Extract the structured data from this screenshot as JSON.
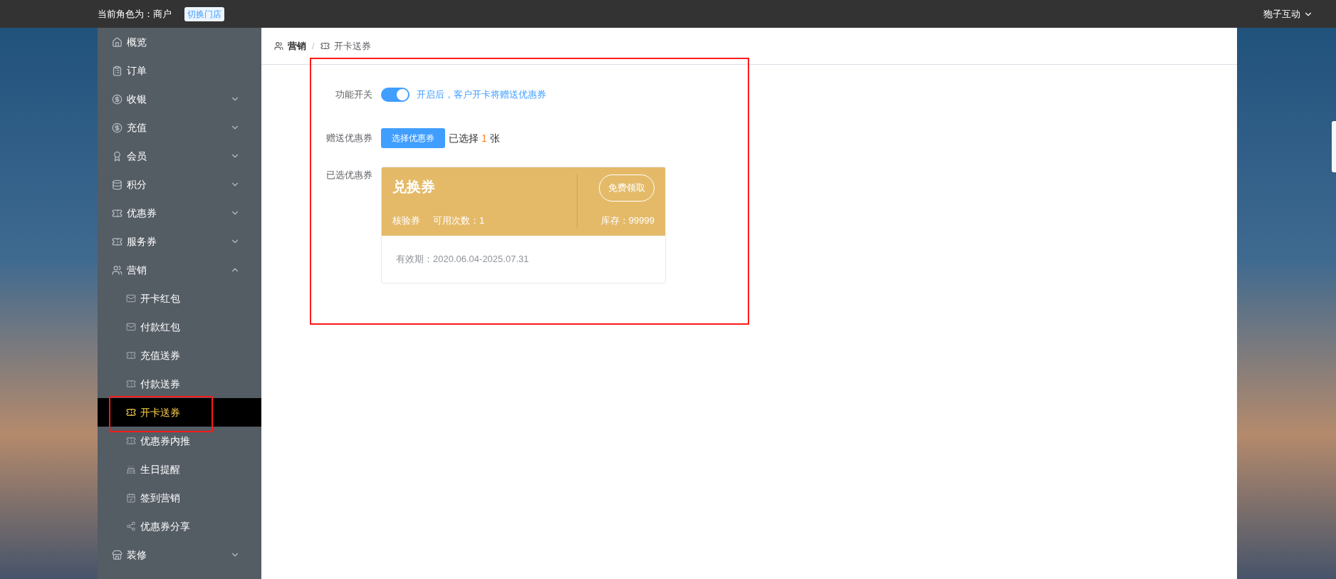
{
  "top_bar": {
    "role_text": "当前角色为：商户",
    "switch_button": "切换门店",
    "user_menu": "狍子互动"
  },
  "sidebar": {
    "items": [
      {
        "label": "概览",
        "kind": "link",
        "selected": false
      },
      {
        "label": "订单",
        "kind": "link",
        "selected": false
      },
      {
        "label": "收银",
        "kind": "menu",
        "expanded": false,
        "selected": false
      },
      {
        "label": "充值",
        "kind": "menu",
        "expanded": false,
        "selected": false
      },
      {
        "label": "会员",
        "kind": "menu",
        "expanded": false,
        "selected": false
      },
      {
        "label": "积分",
        "kind": "menu",
        "expanded": false,
        "selected": false
      },
      {
        "label": "优惠券",
        "kind": "menu",
        "expanded": false,
        "selected": false
      },
      {
        "label": "服务券",
        "kind": "menu",
        "expanded": false,
        "selected": false
      },
      {
        "label": "营销",
        "kind": "menu",
        "expanded": true,
        "selected": false,
        "children": [
          {
            "label": "开卡红包",
            "selected": false
          },
          {
            "label": "付款红包",
            "selected": false
          },
          {
            "label": "充值送券",
            "selected": false
          },
          {
            "label": "付款送券",
            "selected": false
          },
          {
            "label": "开卡送券",
            "selected": true
          },
          {
            "label": "优惠券内推",
            "selected": false
          },
          {
            "label": "生日提醒",
            "selected": false
          },
          {
            "label": "签到营销",
            "selected": false
          },
          {
            "label": "优惠券分享",
            "selected": false
          }
        ]
      },
      {
        "label": "装修",
        "kind": "menu",
        "expanded": false,
        "selected": false
      }
    ]
  },
  "breadcrumb": {
    "items": [
      "营销",
      "开卡送券"
    ],
    "separator": "/"
  },
  "form": {
    "switch_row": {
      "label": "功能开关",
      "on": true,
      "hint": "开启后，客户开卡将赠送优惠券"
    },
    "coupon_row": {
      "label": "赠送优惠券",
      "button": "选择优惠券",
      "selected_prefix": "已选择",
      "selected_count": "1",
      "selected_suffix": "张"
    },
    "selected_row": {
      "label": "已选优惠券",
      "coupon": {
        "title": "兑换券",
        "type": "核验券",
        "uses": "可用次数：1",
        "claim_button": "免费领取",
        "stock": "库存：99999",
        "validity": "有效期：2020.06.04-2025.07.31"
      }
    }
  }
}
